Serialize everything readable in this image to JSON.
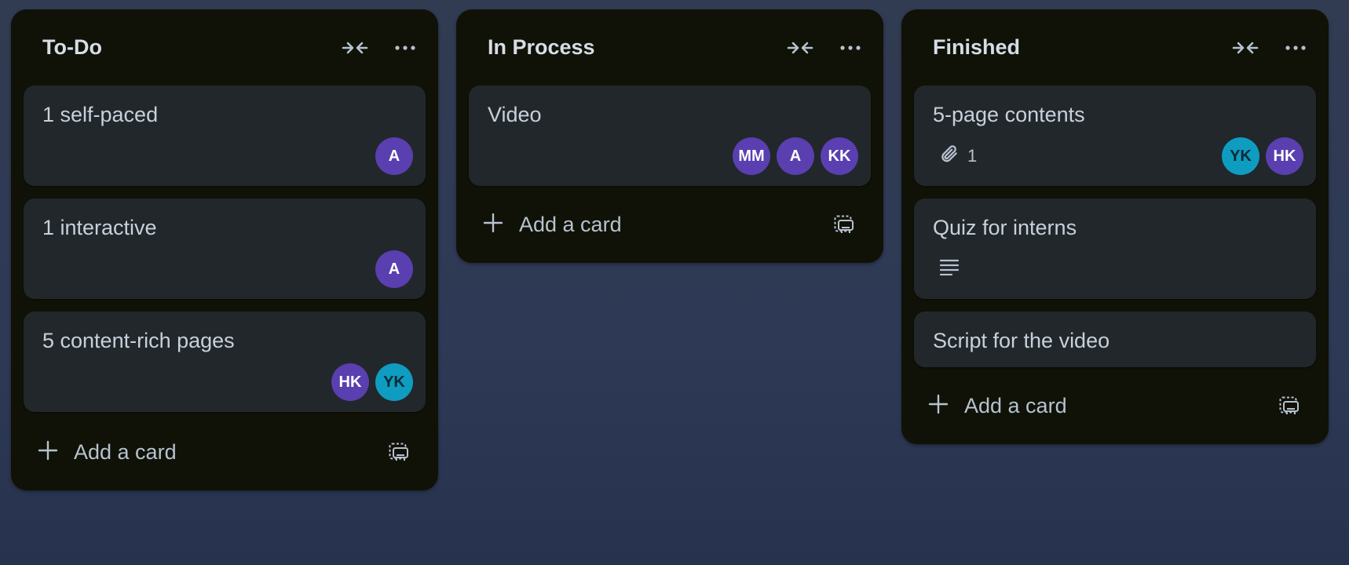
{
  "lists": [
    {
      "title": "To-Do",
      "add_label": "Add a card",
      "cards": [
        {
          "title": "1 self-paced",
          "avatars": [
            "A"
          ]
        },
        {
          "title": "1 interactive",
          "avatars": [
            "A"
          ]
        },
        {
          "title": "5 content-rich pages",
          "avatars": [
            "HK",
            "YK"
          ]
        }
      ]
    },
    {
      "title": "In Process",
      "add_label": "Add a card",
      "cards": [
        {
          "title": "Video",
          "avatars": [
            "MM",
            "A",
            "KK"
          ]
        }
      ]
    },
    {
      "title": "Finished",
      "add_label": "Add a card",
      "cards": [
        {
          "title": "5-page contents",
          "attachment_count": "1",
          "avatars": [
            "YK",
            "HK"
          ]
        },
        {
          "title": "Quiz for interns"
        },
        {
          "title": "Script for the video"
        }
      ]
    }
  ],
  "icons": {
    "collapse": "collapse-arrows-icon",
    "more": "ellipsis-icon",
    "plus": "plus-icon",
    "template": "card-template-icon",
    "attachment": "paperclip-icon",
    "description": "description-lines-icon"
  },
  "colors": {
    "avatar_purple": "#5a3fb0",
    "avatar_teal": "#0e9dc0",
    "list_bg": "#101207",
    "card_bg": "#22272b"
  }
}
